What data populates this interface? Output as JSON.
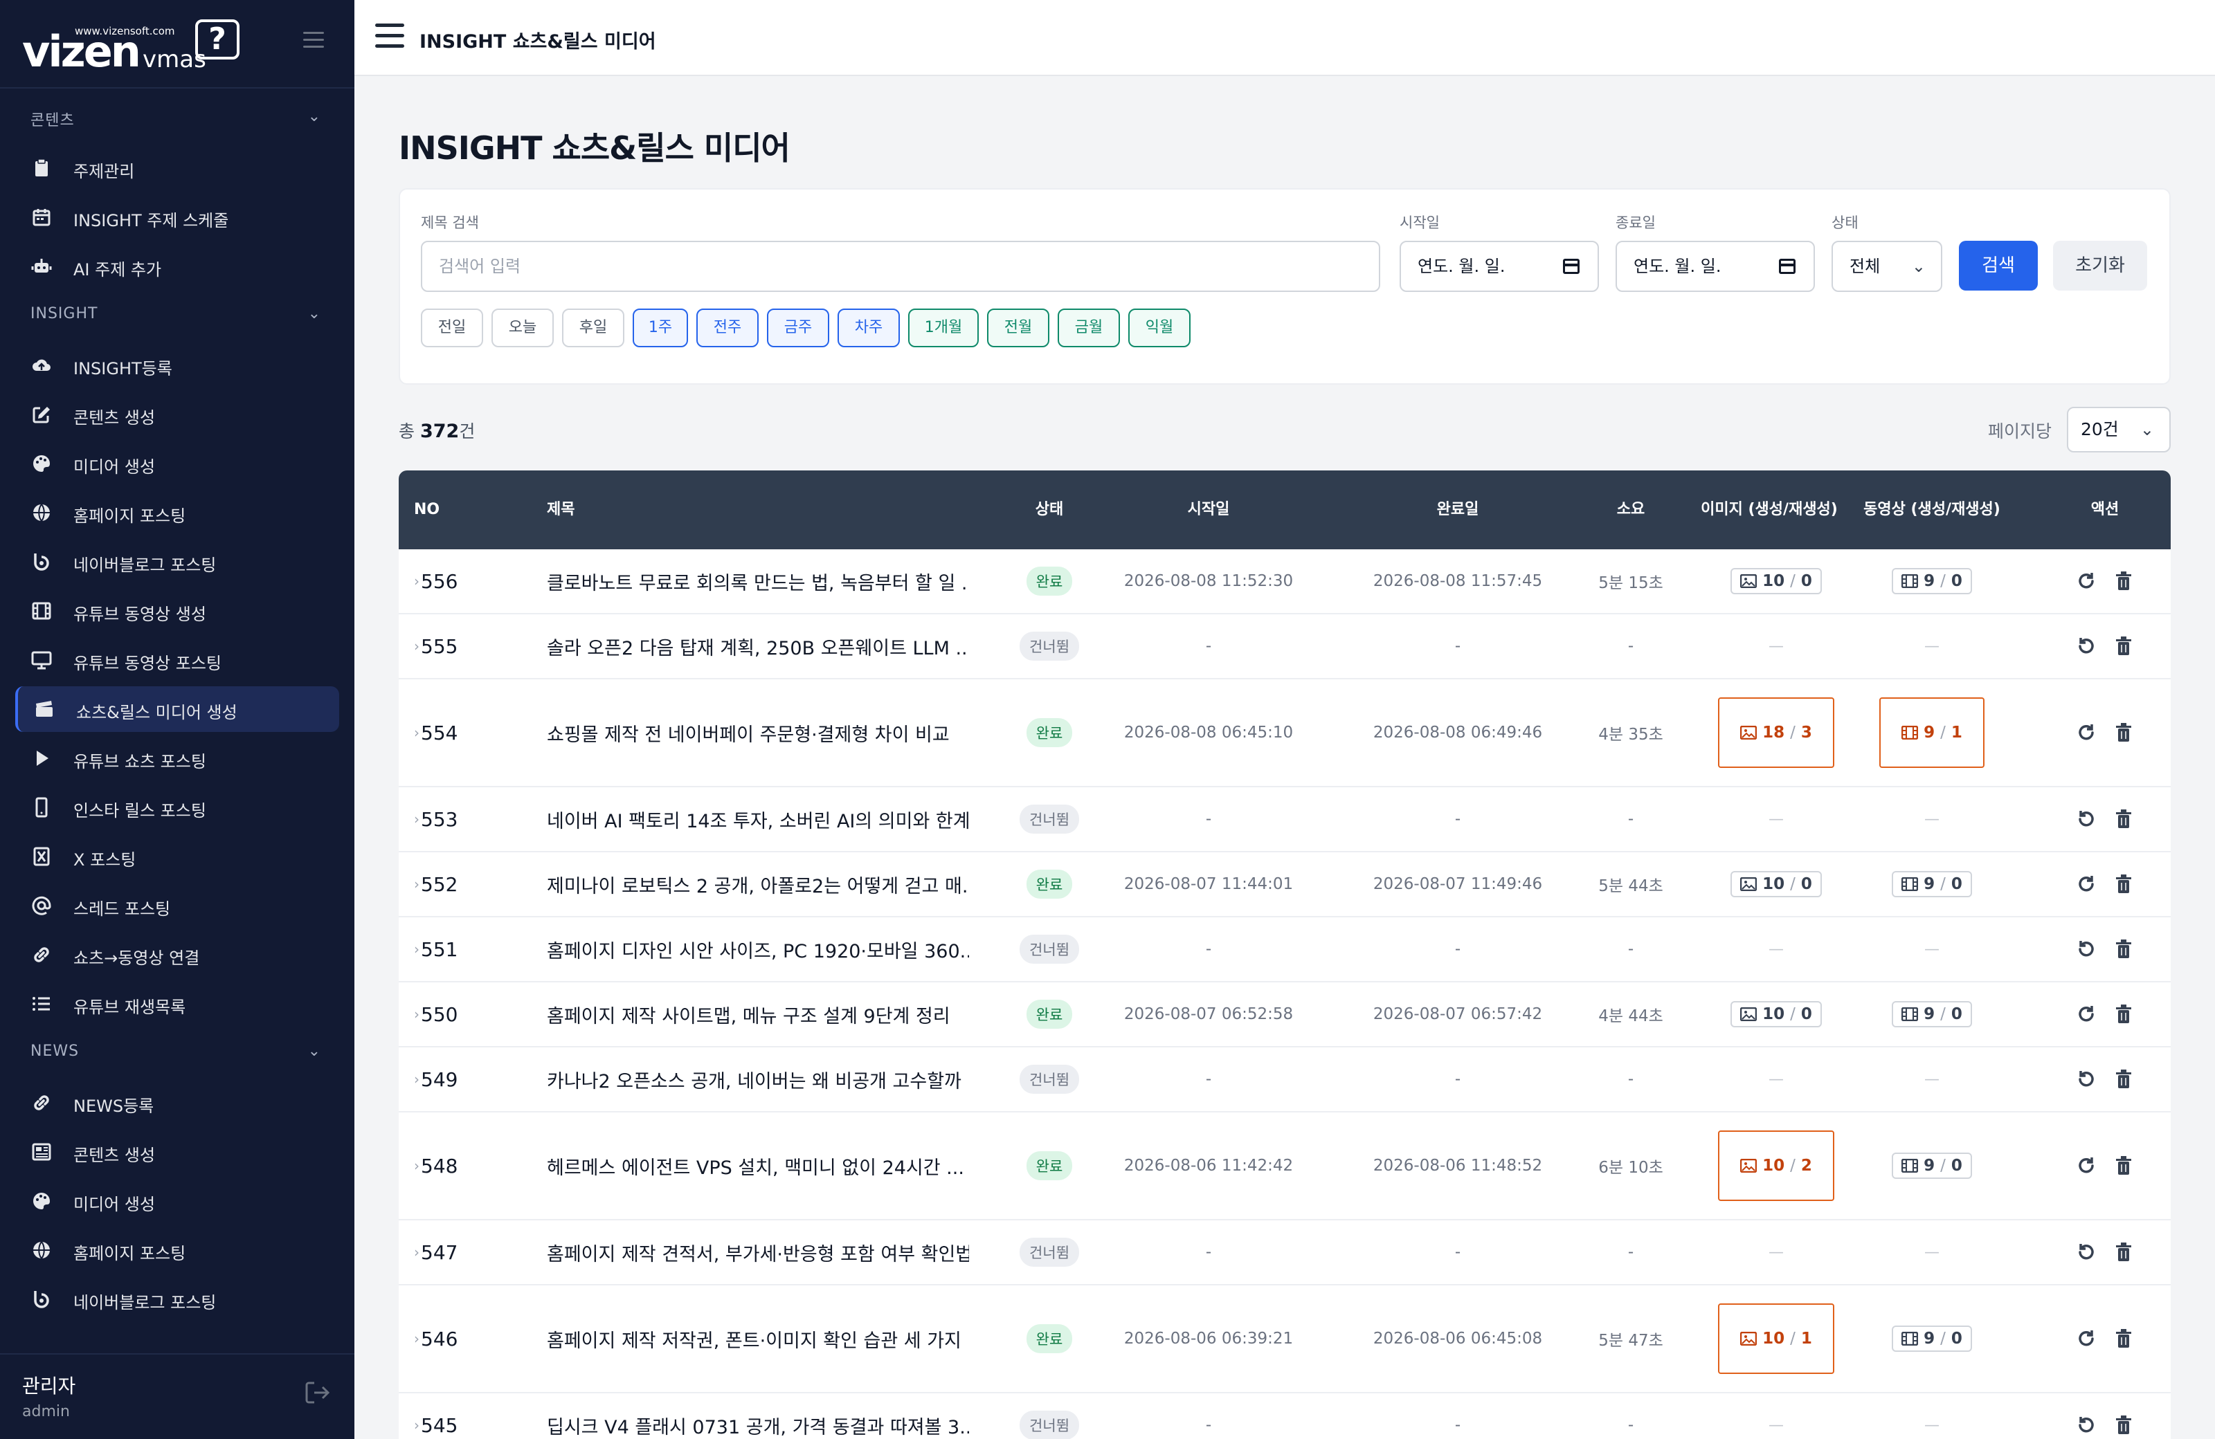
{
  "brand": {
    "url": "www.vizensoft.com",
    "name": "vizen",
    "sub": "vmas",
    "bubble": "?"
  },
  "sidebar": {
    "sections": [
      {
        "label": "콘텐츠",
        "items": [
          {
            "label": "주제관리",
            "icon": "clipboard-icon"
          },
          {
            "label": "INSIGHT 주제 스케줄",
            "icon": "calendar-icon"
          },
          {
            "label": "AI 주제 추가",
            "icon": "robot-icon"
          }
        ]
      },
      {
        "label": "INSIGHT",
        "items": [
          {
            "label": "INSIGHT등록",
            "icon": "cloud-upload-icon"
          },
          {
            "label": "콘텐츠 생성",
            "icon": "edit-icon"
          },
          {
            "label": "미디어 생성",
            "icon": "palette-icon"
          },
          {
            "label": "홈페이지 포스팅",
            "icon": "globe-icon"
          },
          {
            "label": "네이버블로그 포스팅",
            "icon": "blog-icon"
          },
          {
            "label": "유튜브 동영상 생성",
            "icon": "film-icon"
          },
          {
            "label": "유튜브 동영상 포스팅",
            "icon": "monitor-icon"
          },
          {
            "label": "쇼츠&릴스 미디어 생성",
            "icon": "clapperboard-icon",
            "active": true
          },
          {
            "label": "유튜브 쇼츠 포스팅",
            "icon": "play-icon"
          },
          {
            "label": "인스타 릴스 포스팅",
            "icon": "phone-icon"
          },
          {
            "label": "X 포스팅",
            "icon": "x-icon"
          },
          {
            "label": "스레드 포스팅",
            "icon": "at-icon"
          },
          {
            "label": "쇼츠→동영상 연결",
            "icon": "link-icon"
          },
          {
            "label": "유튜브 재생목록",
            "icon": "list-icon"
          }
        ]
      },
      {
        "label": "NEWS",
        "items": [
          {
            "label": "NEWS등록",
            "icon": "link-icon"
          },
          {
            "label": "콘텐츠 생성",
            "icon": "newspaper-icon"
          },
          {
            "label": "미디어 생성",
            "icon": "palette-icon"
          },
          {
            "label": "홈페이지 포스팅",
            "icon": "globe-icon"
          },
          {
            "label": "네이버블로그 포스팅",
            "icon": "blog-icon"
          }
        ]
      }
    ],
    "user": {
      "name": "관리자",
      "id": "admin"
    }
  },
  "topbar": {
    "title": "INSIGHT 쇼츠&릴스 미디어"
  },
  "page": {
    "title": "INSIGHT 쇼츠&릴스 미디어"
  },
  "filters": {
    "title_label": "제목 검색",
    "title_placeholder": "검색어 입력",
    "start_label": "시작일",
    "start_value": "연도. 월. 일.",
    "end_label": "종료일",
    "end_value": "연도. 월. 일.",
    "status_label": "상태",
    "status_value": "전체",
    "search_btn": "검색",
    "reset_btn": "초기화",
    "chips": [
      {
        "label": "전일",
        "style": "gray"
      },
      {
        "label": "오늘",
        "style": "gray"
      },
      {
        "label": "후일",
        "style": "gray"
      },
      {
        "label": "1주",
        "style": "blue"
      },
      {
        "label": "전주",
        "style": "blue"
      },
      {
        "label": "금주",
        "style": "blue"
      },
      {
        "label": "차주",
        "style": "blue"
      },
      {
        "label": "1개월",
        "style": "green"
      },
      {
        "label": "전월",
        "style": "green"
      },
      {
        "label": "금월",
        "style": "green"
      },
      {
        "label": "익월",
        "style": "green"
      }
    ]
  },
  "summary": {
    "prefix": "총 ",
    "count": "372",
    "suffix": "건",
    "perpage_label": "페이지당",
    "perpage_value": "20건"
  },
  "table": {
    "headers": {
      "no": "NO",
      "title": "제목",
      "status": "상태",
      "start": "시작일",
      "end": "완료일",
      "duration": "소요",
      "images": "이미지 (생성/재생성)",
      "videos": "동영상 (생성/재생성)",
      "actions": "액션"
    },
    "rows": [
      {
        "no": "556",
        "title": "클로바노트 무료로 회의록 만드는 법, 녹음부터 할 일 ...",
        "status": "완료",
        "start": "2026-08-08 11:52:30",
        "end": "2026-08-08 11:57:45",
        "duration": "5분 15초",
        "img": [
          "10",
          "0"
        ],
        "vid": [
          "9",
          "0"
        ],
        "img_hl": false,
        "vid_hl": false
      },
      {
        "no": "555",
        "title": "솔라 오픈2 다음 탑재 계획, 250B 오픈웨이트 LLM ...",
        "status": "건너뜀",
        "start": "-",
        "end": "-",
        "duration": "-"
      },
      {
        "no": "554",
        "title": "쇼핑몰 제작 전 네이버페이 주문형·결제형 차이 비교",
        "status": "완료",
        "start": "2026-08-08 06:45:10",
        "end": "2026-08-08 06:49:46",
        "duration": "4분 35초",
        "img": [
          "18",
          "3"
        ],
        "vid": [
          "9",
          "1"
        ],
        "img_hl": true,
        "vid_hl": true
      },
      {
        "no": "553",
        "title": "네이버 AI 팩토리 14조 투자, 소버린 AI의 의미와 한계",
        "status": "건너뜀",
        "start": "-",
        "end": "-",
        "duration": "-"
      },
      {
        "no": "552",
        "title": "제미나이 로보틱스 2 공개, 아폴로2는 어떻게 걷고 매...",
        "status": "완료",
        "start": "2026-08-07 11:44:01",
        "end": "2026-08-07 11:49:46",
        "duration": "5분 44초",
        "img": [
          "10",
          "0"
        ],
        "vid": [
          "9",
          "0"
        ],
        "img_hl": false,
        "vid_hl": false
      },
      {
        "no": "551",
        "title": "홈페이지 디자인 시안 사이즈, PC 1920·모바일 360...",
        "status": "건너뜀",
        "start": "-",
        "end": "-",
        "duration": "-"
      },
      {
        "no": "550",
        "title": "홈페이지 제작 사이트맵, 메뉴 구조 설계 9단계 정리",
        "status": "완료",
        "start": "2026-08-07 06:52:58",
        "end": "2026-08-07 06:57:42",
        "duration": "4분 44초",
        "img": [
          "10",
          "0"
        ],
        "vid": [
          "9",
          "0"
        ],
        "img_hl": false,
        "vid_hl": false
      },
      {
        "no": "549",
        "title": "카나나2 오픈소스 공개, 네이버는 왜 비공개 고수할까",
        "status": "건너뜀",
        "start": "-",
        "end": "-",
        "duration": "-"
      },
      {
        "no": "548",
        "title": "헤르메스 에이전트 VPS 설치, 맥미니 없이 24시간 ...",
        "status": "완료",
        "start": "2026-08-06 11:42:42",
        "end": "2026-08-06 11:48:52",
        "duration": "6분 10초",
        "img": [
          "10",
          "2"
        ],
        "vid": [
          "9",
          "0"
        ],
        "img_hl": true,
        "vid_hl": false
      },
      {
        "no": "547",
        "title": "홈페이지 제작 견적서, 부가세·반응형 포함 여부 확인법",
        "status": "건너뜀",
        "start": "-",
        "end": "-",
        "duration": "-"
      },
      {
        "no": "546",
        "title": "홈페이지 제작 저작권, 폰트·이미지 확인 습관 세 가지",
        "status": "완료",
        "start": "2026-08-06 06:39:21",
        "end": "2026-08-06 06:45:08",
        "duration": "5분 47초",
        "img": [
          "10",
          "1"
        ],
        "vid": [
          "9",
          "0"
        ],
        "img_hl": true,
        "vid_hl": false
      },
      {
        "no": "545",
        "title": "딥시크 V4 플래시 0731 공개, 가격 동결과 따져볼 3...",
        "status": "건너뜀",
        "start": "-",
        "end": "-",
        "duration": "-"
      }
    ],
    "dash": "—"
  },
  "colors": {
    "sidebar_bg": "#121a33",
    "accent": "#2563eb",
    "header_bg": "#303d4f",
    "highlight": "#e0601a",
    "done_badge": "#dcf5e6"
  }
}
